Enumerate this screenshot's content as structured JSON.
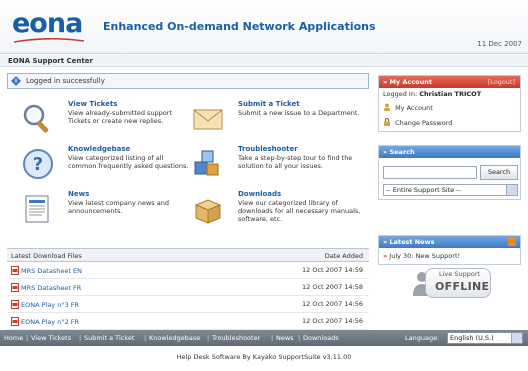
{
  "header": {
    "logo_text": "eona",
    "tagline": "Enhanced On-demand Network Applications",
    "date": "11 Dec 2007"
  },
  "subtitle": "EONA Support Center",
  "notice": "Logged in successfully",
  "features": [
    {
      "title": "View Tickets",
      "desc": "View already-submitted support Tickets or create new replies.",
      "icon": "magnifier-icon"
    },
    {
      "title": "Submit a Ticket",
      "desc": "Submit a new issue to a Department.",
      "icon": "envelope-icon"
    },
    {
      "title": "Knowledgebase",
      "desc": "View categorized listing of all common frequently asked questions.",
      "icon": "question-icon"
    },
    {
      "title": "Troubleshooter",
      "desc": "Take a step-by-step tour to find the solution to all your issues.",
      "icon": "cubes-icon"
    },
    {
      "title": "News",
      "desc": "View latest company news and announcements.",
      "icon": "newspaper-icon"
    },
    {
      "title": "Downloads",
      "desc": "View our categorized library of downloads for all necessary manuals, software, etc.",
      "icon": "box-icon"
    }
  ],
  "downloads": {
    "header_left": "Latest Download Files",
    "header_right": "Date Added",
    "rows": [
      {
        "name": "MRS Datasheet EN",
        "date": "12 Oct 2007 14:59"
      },
      {
        "name": "MRS Datasheet FR",
        "date": "12 Oct 2007 14:58"
      },
      {
        "name": "EONA Play n°3 FR",
        "date": "12 Oct 2007 14:56"
      },
      {
        "name": "EONA Play n°2 FR",
        "date": "12 Oct 2007 14:56"
      }
    ]
  },
  "account": {
    "title": "» My Account",
    "logout": "[Logout]",
    "logged_in_label": "Logged In:",
    "user": "Christian TRICOT",
    "my_account": "My Account",
    "change_password": "Change Password"
  },
  "search": {
    "title": "» Search",
    "button": "Search",
    "scope": "-- Entire Support Site --"
  },
  "news": {
    "title": "» Latest News",
    "item_prefix": "»",
    "item": "July 30: New Support!"
  },
  "live_support": {
    "label": "Live Support",
    "status": "OFFLINE"
  },
  "footer": {
    "links": [
      "Home",
      "View Tickets",
      "Submit a Ticket",
      "Knowledgebase",
      "Troubleshooter",
      "News",
      "Downloads"
    ],
    "language_label": "Language:",
    "language_value": "English (U.S.)"
  },
  "powered_by": "Help Desk Software By Kayako SupportSuite v3.11.00",
  "colors": {
    "brand_blue": "#1a5ea8",
    "account_red": "#c9392c",
    "panel_blue": "#3d79c6",
    "footer_gray": "#6b7681"
  }
}
